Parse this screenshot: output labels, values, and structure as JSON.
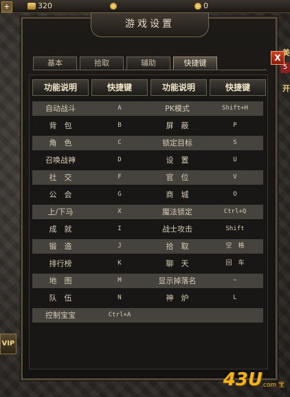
{
  "topbar": {
    "coins": "320",
    "gold": "0"
  },
  "window": {
    "title": "游戏设置",
    "close": "X"
  },
  "tabs": [
    {
      "label": "基本"
    },
    {
      "label": "拾取"
    },
    {
      "label": "辅助"
    },
    {
      "label": "快捷键"
    }
  ],
  "headers": [
    "功能说明",
    "快捷键",
    "功能说明",
    "快捷键"
  ],
  "rows": [
    {
      "f1": "自动战斗",
      "k1": "A",
      "f2": "PK模式",
      "k2": "Shift+H"
    },
    {
      "f1": "背　包",
      "k1": "B",
      "f2": "屏　蔽",
      "k2": "P"
    },
    {
      "f1": "角　色",
      "k1": "C",
      "f2": "锁定目标",
      "k2": "S"
    },
    {
      "f1": "召唤战神",
      "k1": "D",
      "f2": "设　置",
      "k2": "U"
    },
    {
      "f1": "社　交",
      "k1": "F",
      "f2": "官　位",
      "k2": "V"
    },
    {
      "f1": "公　会",
      "k1": "G",
      "f2": "商　城",
      "k2": "O"
    },
    {
      "f1": "上/下马",
      "k1": "X",
      "f2": "魔法锁定",
      "k2": "Ctrl+Q"
    },
    {
      "f1": "成　就",
      "k1": "I",
      "f2": "战士攻击",
      "k2": "Shift"
    },
    {
      "f1": "锻　造",
      "k1": "J",
      "f2": "拾　取",
      "k2": "空　格"
    },
    {
      "f1": "排行榜",
      "k1": "K",
      "f2": "聊　天",
      "k2": "回　车"
    },
    {
      "f1": "地　图",
      "k1": "M",
      "f2": "显示掉落名",
      "k2": "~"
    },
    {
      "f1": "队　伍",
      "k1": "N",
      "f2": "神　炉",
      "k2": "L"
    },
    {
      "f1": "控制宝宝",
      "k1": "Ctrl+A",
      "f2": "",
      "k2": ""
    }
  ],
  "hud": {
    "vip": "VIP",
    "right_label_1": "美",
    "right_badge": "5",
    "right_label_2": "开"
  },
  "watermark": {
    "main": "43U",
    "sub": ".com 宝"
  },
  "colors": {
    "accent": "#c9a45a",
    "close": "#c3361a",
    "row_alt": "#46423d"
  }
}
